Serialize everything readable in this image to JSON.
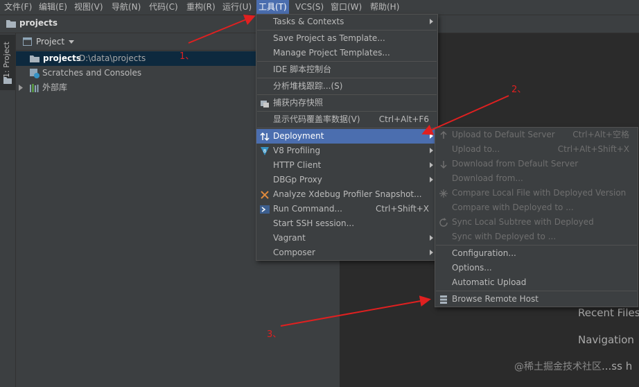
{
  "menubar": {
    "items": [
      {
        "label": "文件(F)"
      },
      {
        "label": "编辑(E)"
      },
      {
        "label": "视图(V)"
      },
      {
        "label": "导航(N)"
      },
      {
        "label": "代码(C)"
      },
      {
        "label": "重构(R)"
      },
      {
        "label": "运行(U)"
      },
      {
        "label": "工具(T)"
      },
      {
        "label": "VCS(S)"
      },
      {
        "label": "窗口(W)"
      },
      {
        "label": "帮助(H)"
      }
    ]
  },
  "navbar": {
    "title": "projects"
  },
  "sidebar": {
    "tab_label": "1: Project"
  },
  "project_panel": {
    "view_label": "Project",
    "tree": [
      {
        "name": "projects",
        "path": "D:\\data\\projects"
      },
      {
        "name": "Scratches and Consoles"
      },
      {
        "name": "外部库"
      }
    ]
  },
  "tools_menu": {
    "items": [
      {
        "label": "Tasks & Contexts",
        "submenu": true
      },
      {
        "label": "Save Project as Template..."
      },
      {
        "label": "Manage Project Templates..."
      },
      {
        "label": "IDE 脚本控制台"
      },
      {
        "label": "分析堆栈跟踪...(S)"
      },
      {
        "label": "捕获内存快照",
        "icon": "memory-snapshot-icon"
      },
      {
        "label": "显示代码覆盖率数据(V)",
        "shortcut": "Ctrl+Alt+F6"
      },
      {
        "label": "Deployment",
        "submenu": true,
        "selected": true,
        "icon": "deployment-icon"
      },
      {
        "label": "V8 Profiling",
        "submenu": true,
        "icon": "v8-icon"
      },
      {
        "label": "HTTP Client",
        "submenu": true
      },
      {
        "label": "DBGp Proxy",
        "submenu": true
      },
      {
        "label": "Analyze Xdebug Profiler Snapshot...",
        "icon": "xdebug-icon"
      },
      {
        "label": "Run Command...",
        "shortcut": "Ctrl+Shift+X",
        "icon": "terminal-icon"
      },
      {
        "label": "Start SSH session..."
      },
      {
        "label": "Vagrant",
        "submenu": true
      },
      {
        "label": "Composer",
        "submenu": true
      }
    ]
  },
  "deployment_menu": {
    "items": [
      {
        "label": "Upload to Default Server",
        "shortcut": "Ctrl+Alt+空格",
        "disabled": true,
        "icon": "upload-icon"
      },
      {
        "label": "Upload to...",
        "shortcut": "Ctrl+Alt+Shift+X",
        "disabled": true
      },
      {
        "label": "Download from Default Server",
        "disabled": true,
        "icon": "download-icon"
      },
      {
        "label": "Download from...",
        "disabled": true
      },
      {
        "label": "Compare Local File with Deployed Version",
        "disabled": true,
        "icon": "compare-icon"
      },
      {
        "label": "Compare with Deployed to ...",
        "disabled": true
      },
      {
        "label": "Sync Local Subtree with Deployed",
        "disabled": true,
        "icon": "sync-icon"
      },
      {
        "label": "Sync with Deployed to ...",
        "disabled": true
      },
      {
        "label": "Configuration..."
      },
      {
        "label": "Options..."
      },
      {
        "label": "Automatic Upload"
      },
      {
        "label": "Browse Remote Host",
        "icon": "remote-host-icon"
      }
    ]
  },
  "welcome": {
    "recent_files": "Recent Files",
    "navigation": "Navigation",
    "truncated": "...ss h"
  },
  "annotations": [
    "1、",
    "2、",
    "3、"
  ],
  "watermark": "@稀土掘金技术社区",
  "colors": {
    "menubar_bg": "#3c3f41",
    "selection": "#4b6eaf",
    "annotation_red": "#e02020"
  }
}
